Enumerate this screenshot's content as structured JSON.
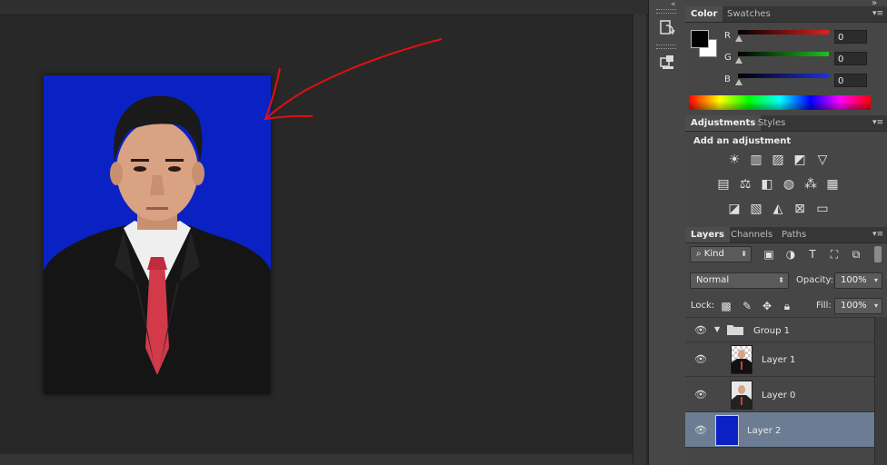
{
  "color_panel": {
    "tabs": [
      {
        "label": "Color",
        "active": true
      },
      {
        "label": "Swatches",
        "active": false
      }
    ],
    "channels": [
      {
        "label": "R",
        "value": "0",
        "color": "#e02020"
      },
      {
        "label": "G",
        "value": "0",
        "color": "#20c020"
      },
      {
        "label": "B",
        "value": "0",
        "color": "#2030e0"
      }
    ],
    "foreground": "#000000",
    "background": "#ffffff"
  },
  "adjustments_panel": {
    "tabs": [
      {
        "label": "Adjustments",
        "active": true
      },
      {
        "label": "Styles",
        "active": false
      }
    ],
    "heading": "Add an adjustment",
    "rows": [
      [
        "brightness-contrast-icon",
        "levels-icon",
        "curves-icon",
        "exposure-icon",
        "vibrance-icon"
      ],
      [
        "hue-saturation-icon",
        "color-balance-icon",
        "black-white-icon",
        "photo-filter-icon",
        "channel-mixer-icon",
        "color-lookup-icon"
      ],
      [
        "invert-icon",
        "posterize-icon",
        "threshold-icon",
        "selective-color-icon",
        "gradient-map-icon"
      ]
    ]
  },
  "layers_panel": {
    "tabs": [
      {
        "label": "Layers",
        "active": true
      },
      {
        "label": "Channels",
        "active": false
      },
      {
        "label": "Paths",
        "active": false
      }
    ],
    "filter": {
      "value": "Kind"
    },
    "blend_mode": "Normal",
    "opacity_label": "Opacity:",
    "opacity": "100%",
    "lock_label": "Lock:",
    "fill_label": "Fill:",
    "fill": "100%",
    "layers": [
      {
        "name": "Group 1",
        "type": "group",
        "visible": true,
        "selected": false
      },
      {
        "name": "Layer 1",
        "type": "layer",
        "visible": true,
        "selected": false
      },
      {
        "name": "Layer 0",
        "type": "layer",
        "visible": true,
        "selected": false
      },
      {
        "name": "Layer 2",
        "type": "fill",
        "visible": true,
        "selected": true
      }
    ]
  },
  "document": {
    "photo_background": "#0a22c4",
    "annotation_color": "#e01010"
  }
}
